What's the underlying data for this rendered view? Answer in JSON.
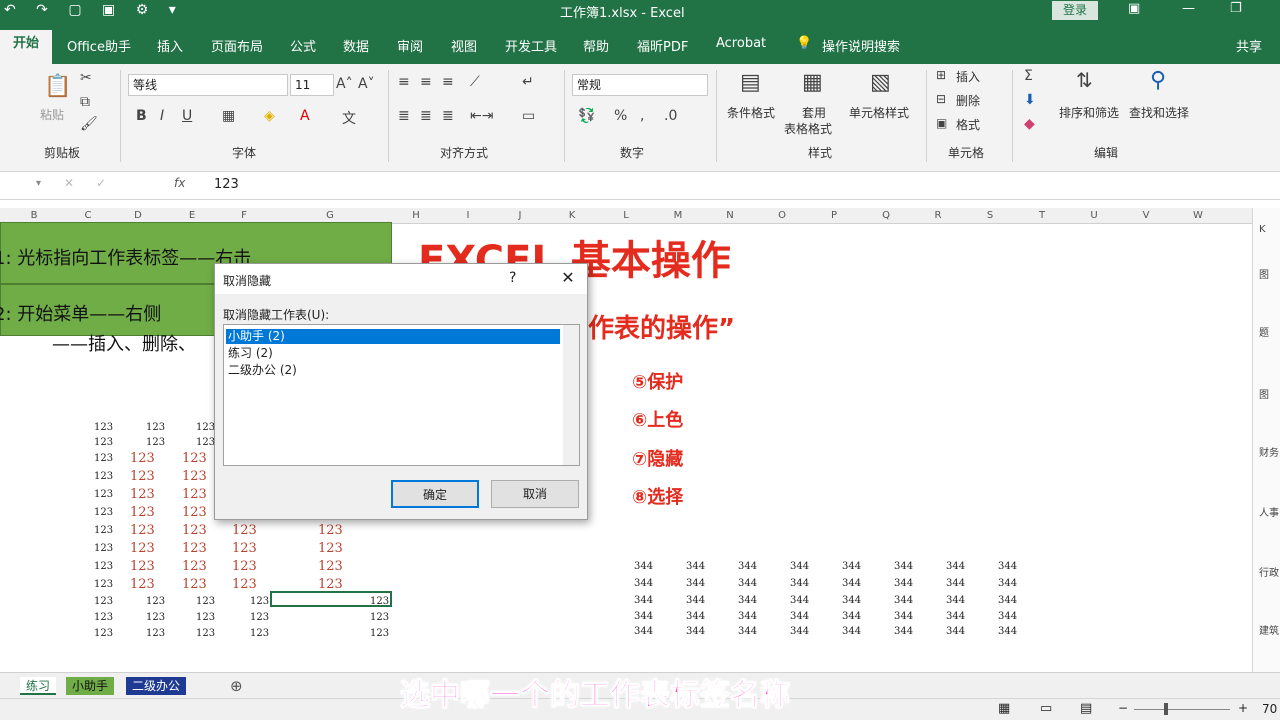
{
  "titlebar": {
    "title": "工作簿1.xlsx - Excel",
    "login": "登录"
  },
  "tabs": [
    "开始",
    "Office助手",
    "插入",
    "页面布局",
    "公式",
    "数据",
    "审阅",
    "视图",
    "开发工具",
    "帮助",
    "福昕PDF",
    "Acrobat",
    "操作说明搜索",
    "共享"
  ],
  "ribbon": {
    "paste_label": "粘贴",
    "clipboard_label": "剪贴板",
    "font_name": "等线",
    "font_size": "11",
    "bold": "B",
    "italic": "I",
    "underline": "U",
    "font_label": "字体",
    "align_label": "对齐方式",
    "number_format": "常规",
    "number_label": "数字",
    "cond_format": "条件格式",
    "table_format_1": "套用",
    "table_format_2": "表格格式",
    "cell_style": "单元格样式",
    "style_label": "样式",
    "insert": "插入",
    "delete": "删除",
    "format": "格式",
    "cells_label": "单元格",
    "sort_filter": "排序和筛选",
    "find_select": "查找和选择",
    "edit_label": "编辑"
  },
  "formula_bar": {
    "fx": "fx",
    "value": "123"
  },
  "columns": [
    "B",
    "C",
    "D",
    "E",
    "F",
    "G",
    "H",
    "I",
    "J",
    "K",
    "L",
    "M",
    "N",
    "O",
    "P",
    "Q",
    "R",
    "S",
    "T",
    "U",
    "V",
    "W"
  ],
  "sheet": {
    "green_line1": "1:  光标指向工作表标签——右击",
    "green_line2": "2:  开始菜单——右侧",
    "green_line3": "——插入、删除、",
    "big_title": "EXCEL 基本操作",
    "sub_title": "作表的操作”",
    "list": [
      "⑤保护",
      "⑥上色",
      "⑦隐藏",
      "⑧选择"
    ],
    "cell_123": "123",
    "cell_344": "344"
  },
  "dialog": {
    "title": "取消隐藏",
    "help": "?",
    "close": "✕",
    "label": "取消隐藏工作表(U):",
    "items": [
      "小助手 (2)",
      "练习 (2)",
      "二级办公 (2)"
    ],
    "ok": "确定",
    "cancel": "取消"
  },
  "right_pane": [
    "K",
    "图",
    "题",
    "图",
    "财务",
    "人事",
    "行政",
    "建筑"
  ],
  "sheet_tabs": [
    "练习",
    "小助手",
    "二级办公"
  ],
  "caption": "选中哪一个的工作表标签名称",
  "status": {
    "zoom": "70"
  },
  "colors": {
    "excel_green": "#217346",
    "cell_green": "#70ad47",
    "title_red": "#e32b1e",
    "select_blue": "#0078d7",
    "caption_pink": "#ff44cc"
  }
}
